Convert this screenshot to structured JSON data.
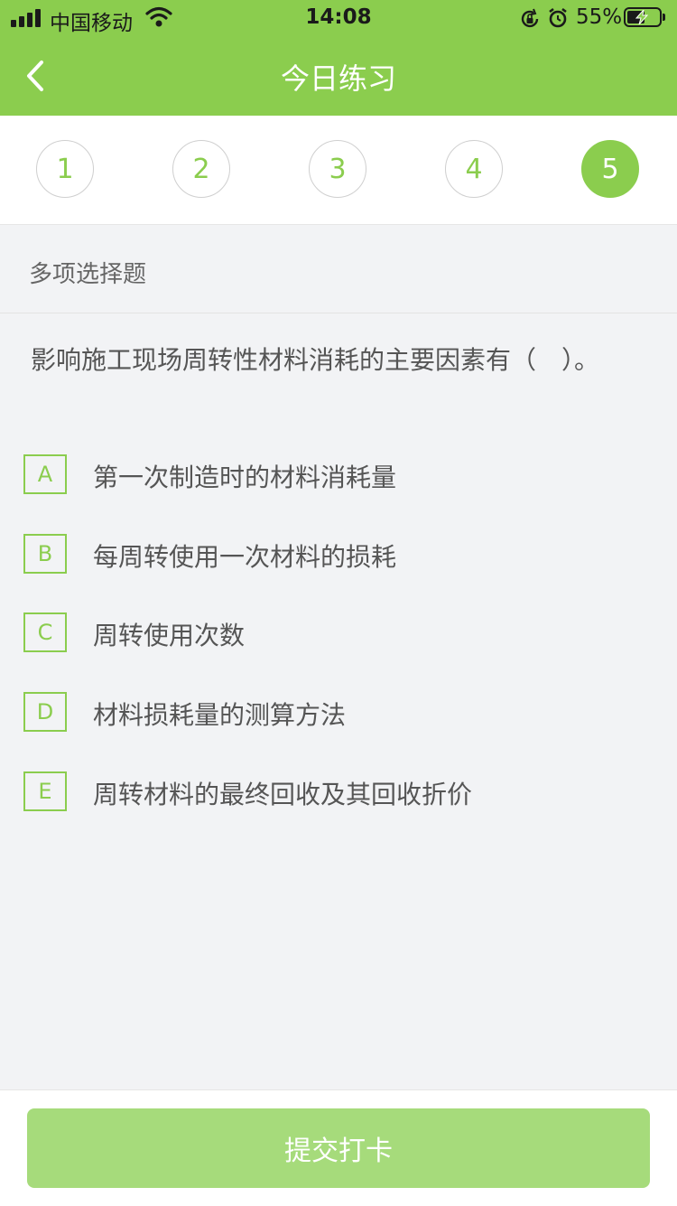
{
  "status_bar": {
    "carrier": "中国移动",
    "time": "14:08",
    "battery_percent": "55%",
    "battery_level": 0.55,
    "icons": [
      "signal-icon",
      "wifi-icon",
      "orientation-lock-icon",
      "alarm-icon",
      "battery-charging-icon"
    ]
  },
  "nav": {
    "title": "今日练习",
    "back_icon": "chevron-left-icon"
  },
  "question_numbers": [
    {
      "label": "1"
    },
    {
      "label": "2"
    },
    {
      "label": "3"
    },
    {
      "label": "4"
    },
    {
      "label": "5"
    }
  ],
  "active_question": "5",
  "question": {
    "type": "多项选择题",
    "text": "影响施工现场周转性材料消耗的主要因素有（　）。",
    "options": [
      {
        "letter": "A",
        "text": "第一次制造时的材料消耗量"
      },
      {
        "letter": "B",
        "text": "每周转使用一次材料的损耗"
      },
      {
        "letter": "C",
        "text": "周转使用次数"
      },
      {
        "letter": "D",
        "text": "材料损耗量的测算方法"
      },
      {
        "letter": "E",
        "text": "周转材料的最终回收及其回收折价"
      }
    ]
  },
  "submit_label": "提交打卡",
  "colors": {
    "accent": "#8bcd4e",
    "submit_button": "#a6db7b",
    "background": "#f2f3f5"
  }
}
